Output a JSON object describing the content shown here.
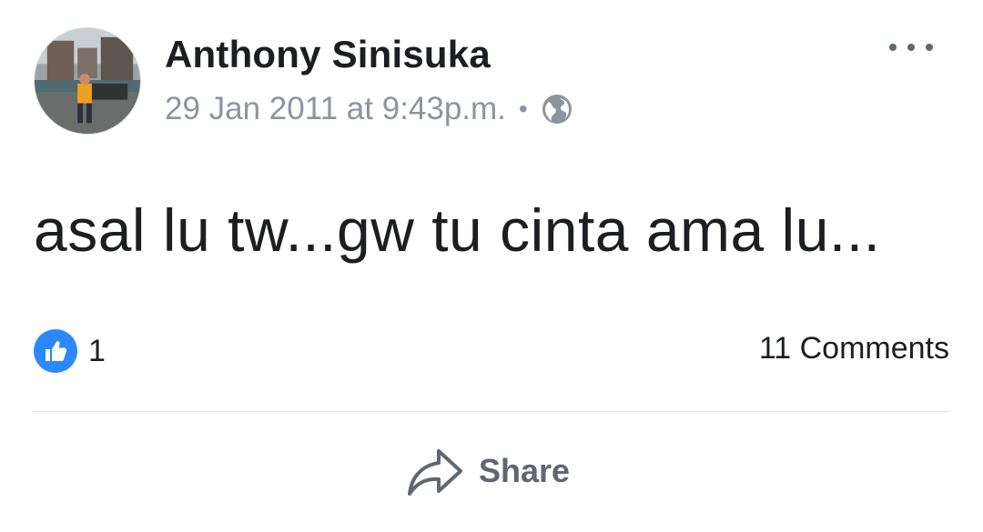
{
  "post": {
    "author": "Anthony Sinisuka",
    "timestamp": "29 Jan 2011 at 9:43p.m.",
    "separator": "•",
    "privacy_icon": "globe-icon",
    "more_icon": "more-options-icon",
    "message": "asal lu tw...gw tu cinta ama lu...",
    "reactions": {
      "icon": "like-icon",
      "count": "1",
      "color": "#2d88ff"
    },
    "comments_label": "11 Comments",
    "actions": {
      "share_label": "Share",
      "share_icon": "share-arrow-icon"
    }
  }
}
